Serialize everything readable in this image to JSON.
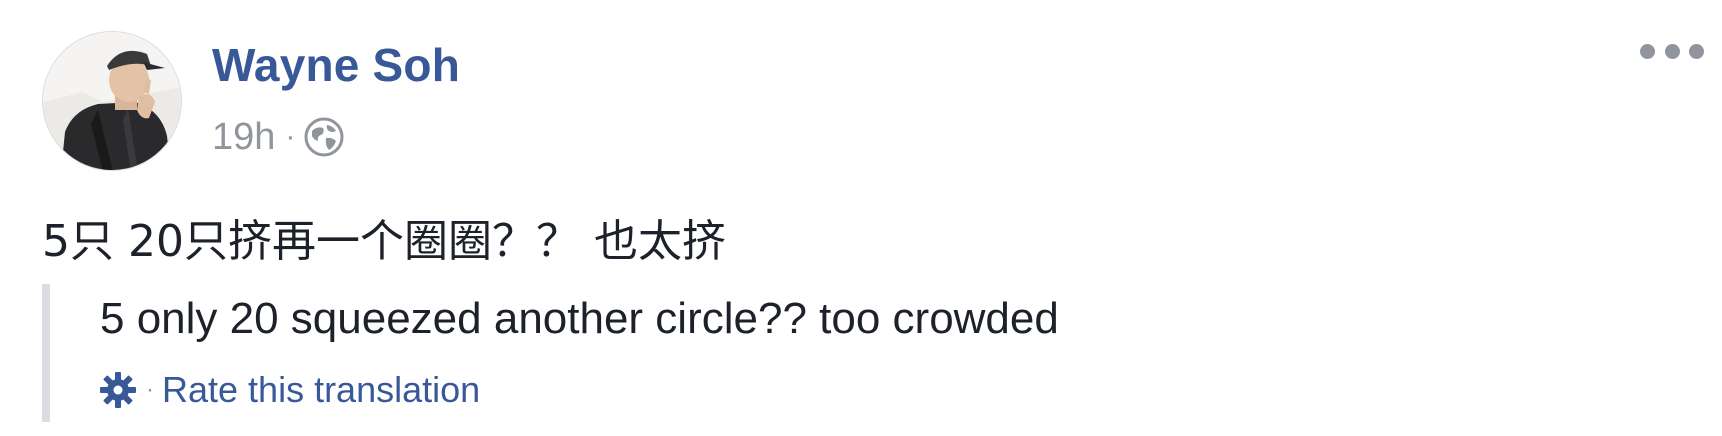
{
  "post": {
    "author": {
      "name": "Wayne Soh",
      "avatar_icon": "user-avatar-photo"
    },
    "meta": {
      "time": "19h",
      "separator": "·",
      "privacy_icon": "globe-icon"
    },
    "more_icon": "ellipsis-icon",
    "text": "5只 20只挤再一个圈圈？？ 也太挤",
    "translation": {
      "text": "5 only 20 squeezed another circle?? too crowded",
      "settings_icon": "gear-icon",
      "separator": "·",
      "rate_label": "Rate this translation"
    }
  },
  "colors": {
    "link": "#385898",
    "meta": "#90949c",
    "text": "#1d2129",
    "border": "#dadde1"
  }
}
